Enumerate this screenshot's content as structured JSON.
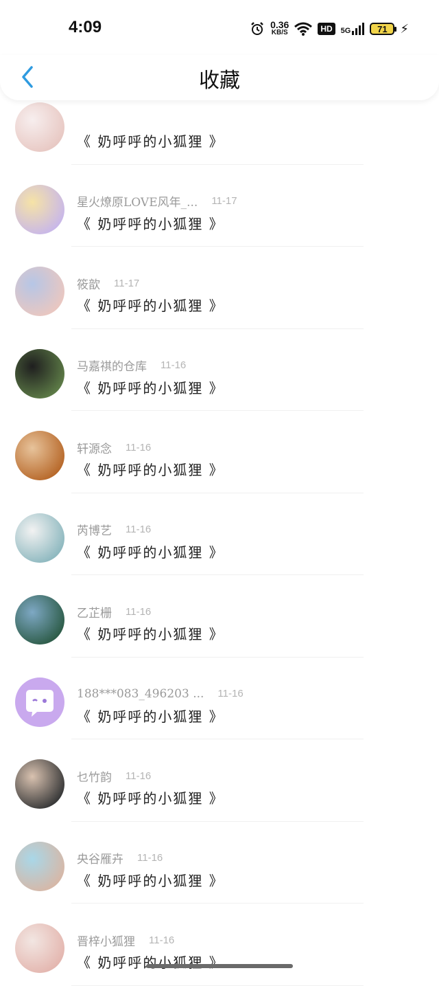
{
  "status_bar": {
    "time": "4:09",
    "net_speed": "0.36",
    "net_speed_unit": "KB/S",
    "hd_label": "HD",
    "network_label": "5G",
    "battery_level": "71"
  },
  "header": {
    "title": "收藏"
  },
  "items": [
    {
      "sender": "",
      "date": "",
      "title": "《 奶呼呼的小狐狸 》",
      "avatar_color": "#e8c9c4",
      "avatar_color2": "#f7eeee"
    },
    {
      "sender": "星火燎原LOVE风年_...",
      "date": "11-17",
      "title": "《 奶呼呼的小狐狸 》",
      "avatar_color": "#c9b8e8",
      "avatar_color2": "#f6e3a6"
    },
    {
      "sender": "筱歆",
      "date": "11-17",
      "title": "《 奶呼呼的小狐狸 》",
      "avatar_color": "#e9c7c1",
      "avatar_color2": "#b6c6e6"
    },
    {
      "sender": "马嘉祺的仓库",
      "date": "11-16",
      "title": "《 奶呼呼的小狐狸 》",
      "avatar_color": "#5c7a46",
      "avatar_color2": "#1f1f1f"
    },
    {
      "sender": "轩源念",
      "date": "11-16",
      "title": "《 奶呼呼的小狐狸 》",
      "avatar_color": "#b86a2c",
      "avatar_color2": "#e7c39b"
    },
    {
      "sender": "芮博艺",
      "date": "11-16",
      "title": "《 奶呼呼的小狐狸 》",
      "avatar_color": "#8fb9c0",
      "avatar_color2": "#f2f2f2"
    },
    {
      "sender": "乙芷栅",
      "date": "11-16",
      "title": "《 奶呼呼的小狐狸 》",
      "avatar_color": "#2e5d4a",
      "avatar_color2": "#7ea8c4"
    },
    {
      "sender": "188***083_496203 ...",
      "date": "11-16",
      "title": "《 奶呼呼的小狐狸 》",
      "avatar_color": "#c9a9ee",
      "avatar_color2": "#c9a9ee"
    },
    {
      "sender": "乜竹韵",
      "date": "11-16",
      "title": "《 奶呼呼的小狐狸 》",
      "avatar_color": "#3a3a3a",
      "avatar_color2": "#d9c2b0"
    },
    {
      "sender": "央谷雁卉",
      "date": "11-16",
      "title": "《 奶呼呼的小狐狸 》",
      "avatar_color": "#d6b8a8",
      "avatar_color2": "#a9d7e8"
    },
    {
      "sender": "晋梓小狐狸",
      "date": "11-16",
      "title": "《 奶呼呼的小狐狸 》",
      "avatar_color": "#e4b7b0",
      "avatar_color2": "#f2e6e2"
    }
  ],
  "colors": {
    "accent": "#2f9be0"
  }
}
